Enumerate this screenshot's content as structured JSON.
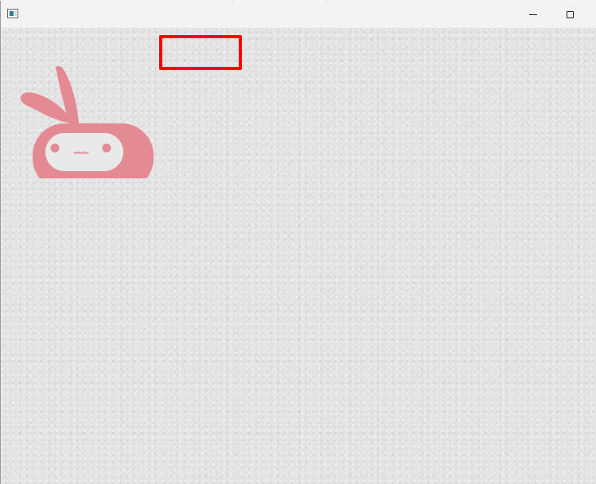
{
  "window": {
    "icon": "app-window-icon",
    "controls": {
      "minimize_icon": "minimize-icon",
      "maximize_icon": "maximize-icon"
    }
  },
  "canvas": {
    "mascot": "bunny-mascot-icon",
    "highlight": "red-rectangle"
  },
  "colors": {
    "mascot": "#e38a93",
    "highlight": "#ff0000",
    "background": "#e3e3e3"
  }
}
